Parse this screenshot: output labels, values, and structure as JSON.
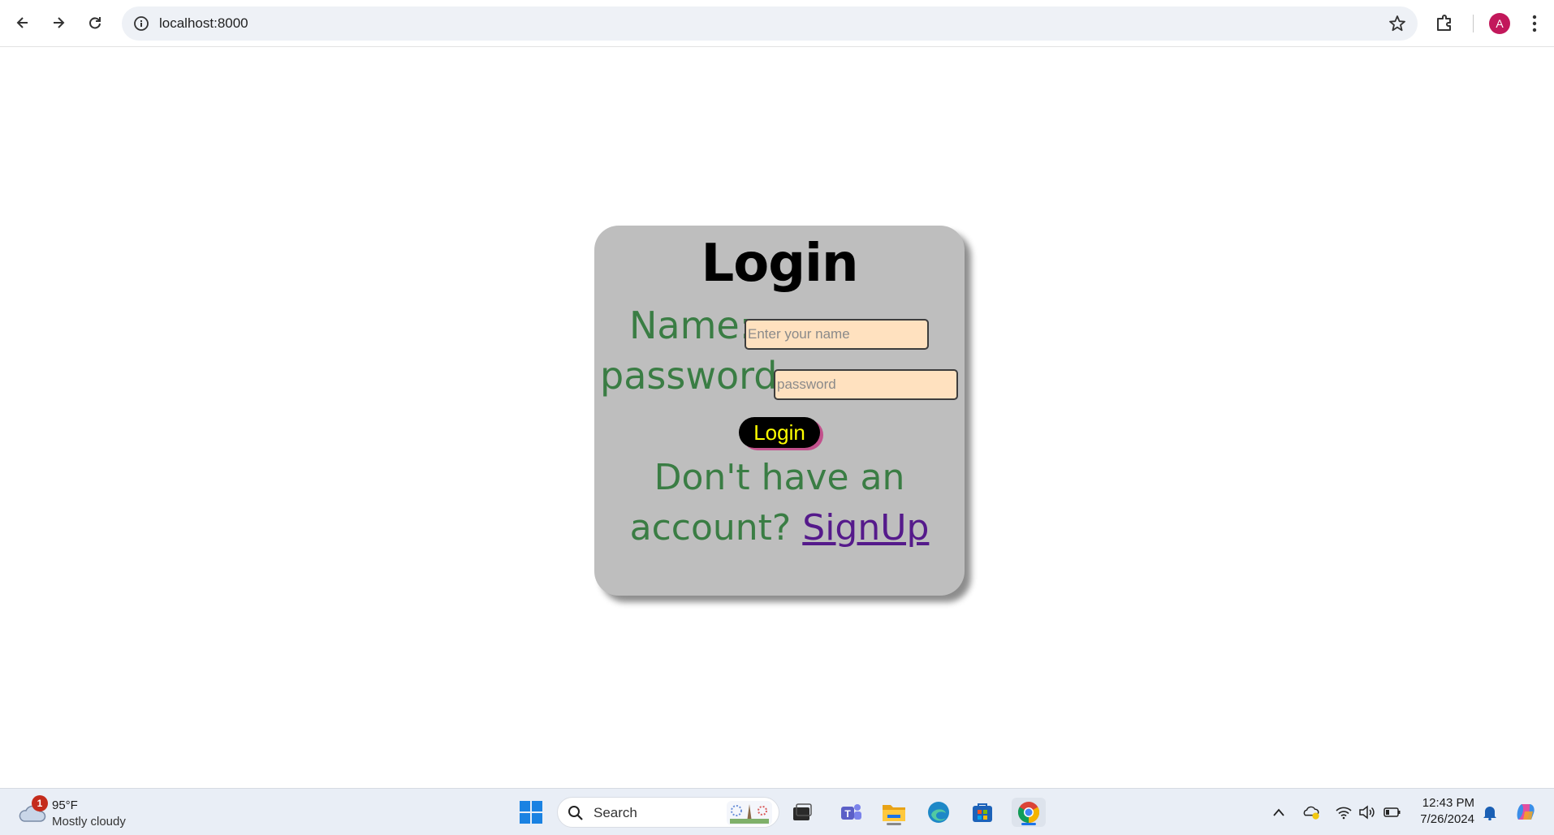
{
  "browser": {
    "url": "localhost:8000",
    "avatar_letter": "A"
  },
  "login_card": {
    "title": "Login",
    "name_label": "Name:",
    "name_placeholder": "Enter your name",
    "password_label": "password:",
    "password_placeholder": "password",
    "login_button": "Login",
    "signup_prefix": "Don't have an account?",
    "signup_link": "SignUp"
  },
  "taskbar": {
    "weather_badge": "1",
    "weather_temp": "95°F",
    "weather_condition": "Mostly cloudy",
    "search_label": "Search",
    "time": "12:43 PM",
    "date": "7/26/2024",
    "apps": [
      "start-icon",
      "task-view-icon",
      "teams-icon",
      "file-explorer-icon",
      "edge-icon",
      "store-icon",
      "chrome-icon"
    ]
  },
  "colors": {
    "card_bg": "#bebebe",
    "label_green": "#3a7d44",
    "input_bg": "#ffe1bf",
    "button_text": "#ffff00",
    "link_purple": "#551a8b"
  }
}
